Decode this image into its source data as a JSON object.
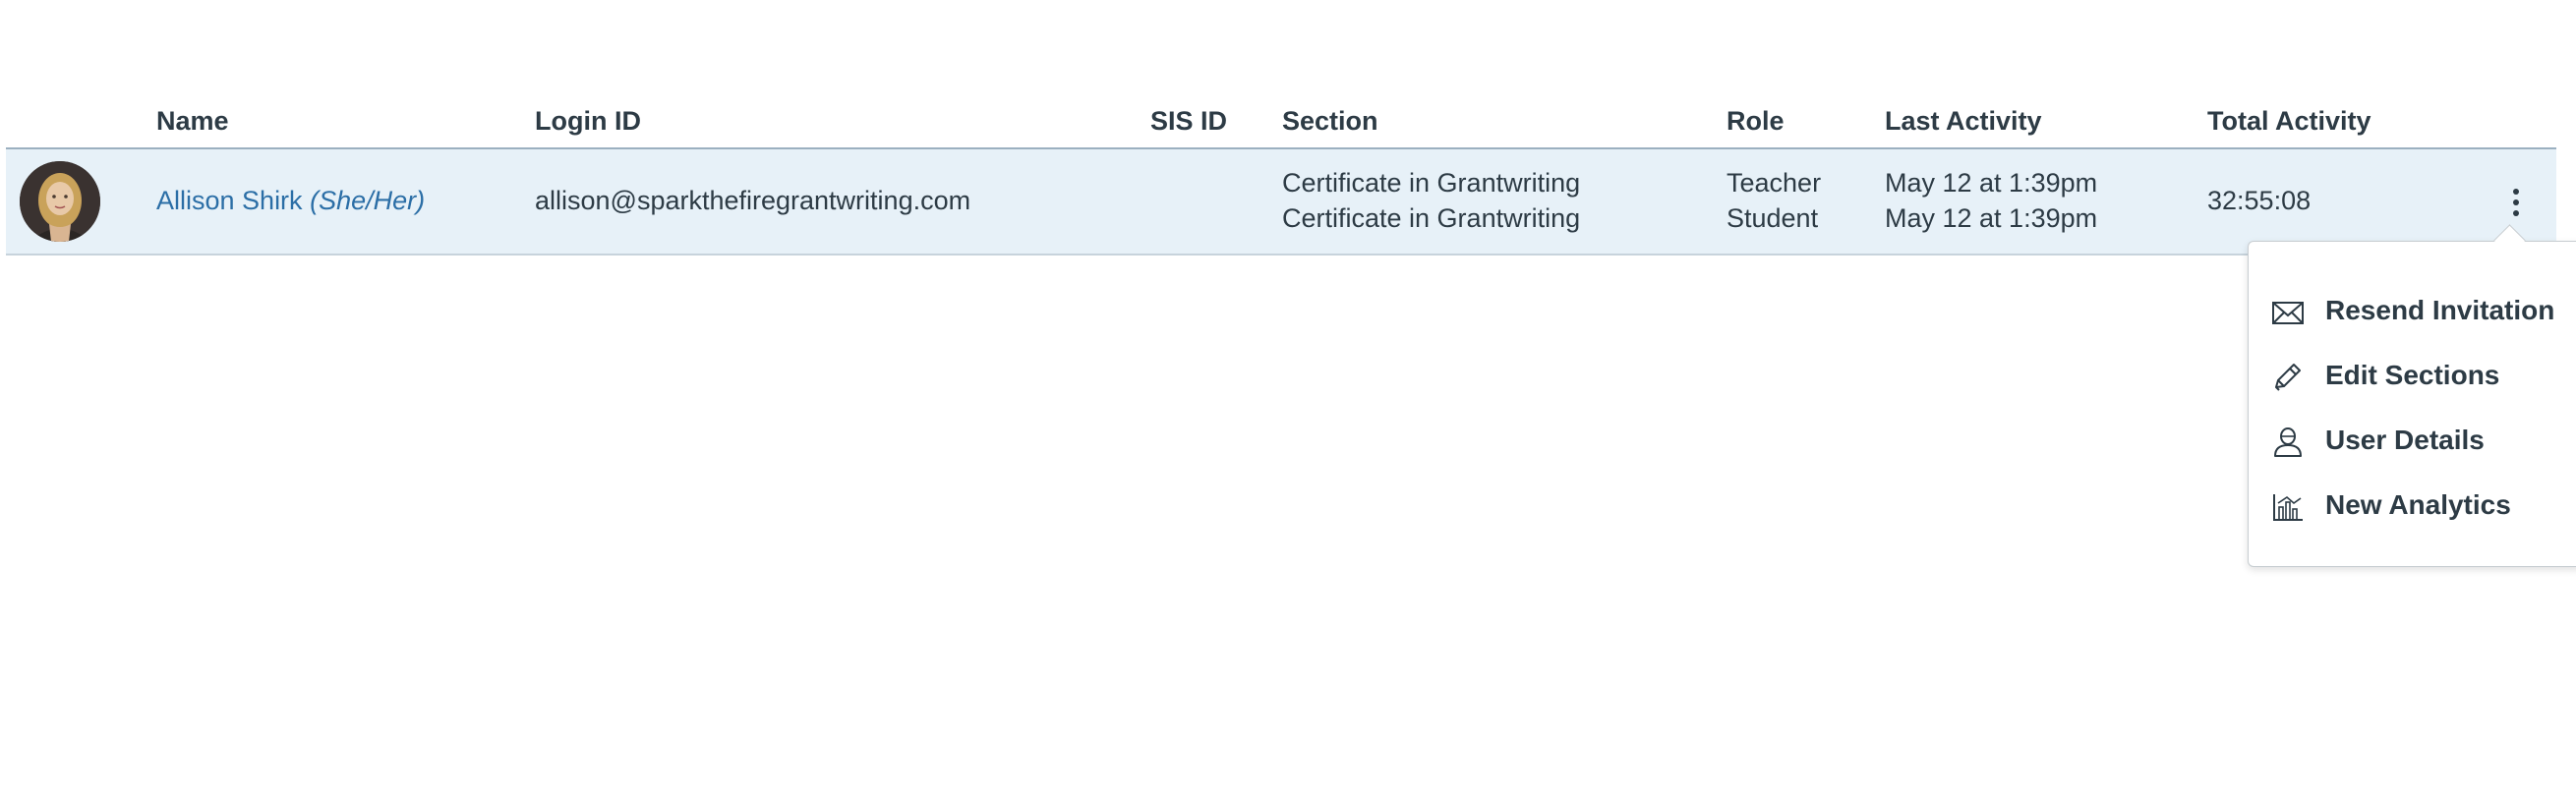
{
  "table": {
    "headers": {
      "name": "Name",
      "login_id": "Login ID",
      "sis_id": "SIS ID",
      "section": "Section",
      "role": "Role",
      "last_activity": "Last Activity",
      "total_activity": "Total Activity"
    },
    "rows": [
      {
        "name": "Allison Shirk",
        "pronouns": "(She/Her)",
        "login_id": "allison@sparkthefiregrantwriting.com",
        "sis_id": "",
        "sections": [
          "Certificate in Grantwriting",
          "Certificate in Grantwriting"
        ],
        "roles": [
          "Teacher",
          "Student"
        ],
        "last_activity": [
          "May 12 at 1:39pm",
          "May 12 at 1:39pm"
        ],
        "total_activity": "32:55:08"
      }
    ]
  },
  "menu": {
    "items": [
      {
        "label": "Resend Invitation",
        "icon": "envelope-icon"
      },
      {
        "label": "Edit Sections",
        "icon": "pencil-icon"
      },
      {
        "label": "User Details",
        "icon": "user-icon"
      },
      {
        "label": "New Analytics",
        "icon": "analytics-icon"
      }
    ]
  },
  "colors": {
    "row_highlight": "#e7f1f8",
    "link": "#2b6ea6",
    "text": "#2d3b45"
  }
}
